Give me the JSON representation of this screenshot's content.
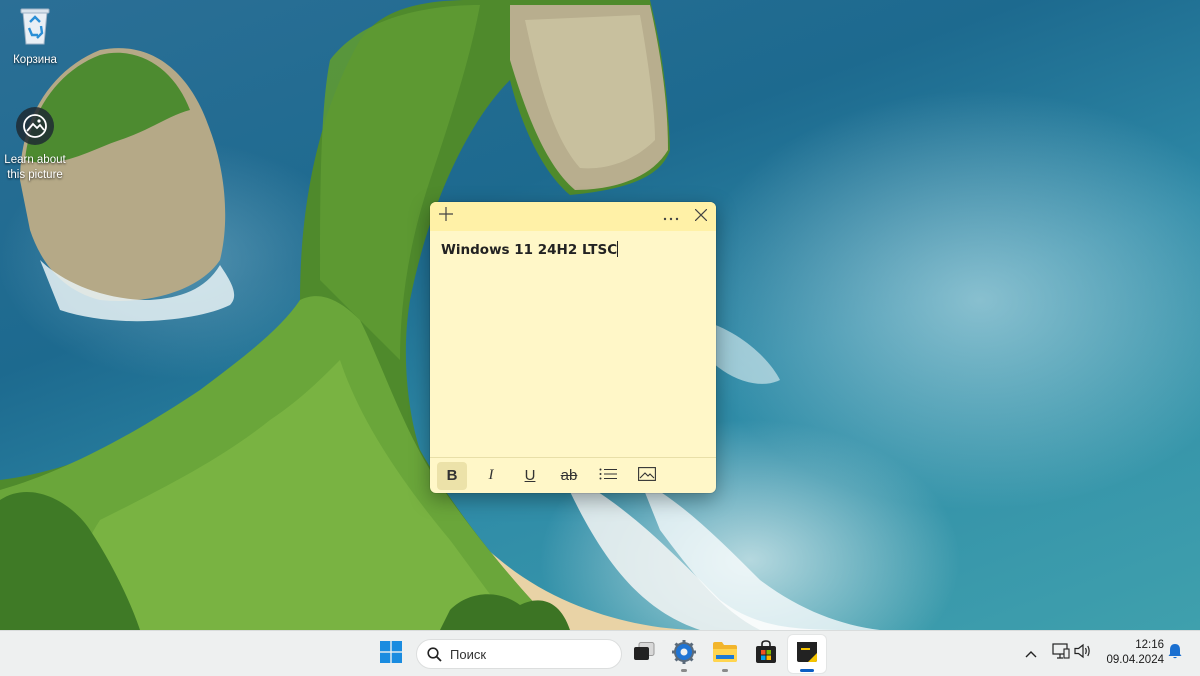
{
  "desktop": {
    "icons": [
      {
        "label": "Корзина",
        "icon": "recycle-bin-icon"
      },
      {
        "label_line1": "Learn about",
        "label_line2": "this picture",
        "icon": "camera-lens-icon"
      }
    ]
  },
  "sticky_note": {
    "title_bar": {
      "new_note_icon": "plus-icon",
      "menu_icon": "ellipsis-icon",
      "close_icon": "close-icon"
    },
    "content": "Windows 11 24H2 LTSC",
    "background_color": "#fff7c8",
    "titlebar_color": "#fff1a7",
    "toolbar": {
      "bold_label": "B",
      "italic_label": "I",
      "underline_label": "U",
      "strikethrough_label": "ab",
      "bullets_icon": "bullet-list-icon",
      "image_icon": "image-icon",
      "bold_active": true
    }
  },
  "taskbar": {
    "start_icon": "windows-logo-icon",
    "search_placeholder": "Поиск",
    "apps": [
      {
        "name": "task-view",
        "icon": "task-view-icon",
        "running": false
      },
      {
        "name": "settings",
        "icon": "gear-icon",
        "running": true
      },
      {
        "name": "file-explorer",
        "icon": "folder-icon",
        "running": true
      },
      {
        "name": "microsoft-store",
        "icon": "store-bag-icon",
        "running": false
      },
      {
        "name": "sticky-notes",
        "icon": "sticky-notes-icon",
        "running": true,
        "active": true
      }
    ],
    "tray": {
      "overflow_icon": "chevron-up-icon",
      "network_icon": "network-icon",
      "volume_icon": "speaker-icon",
      "notifications_icon": "bell-icon"
    },
    "clock": {
      "time": "12:16",
      "date": "09.04.2024"
    },
    "accent_color": "#0a5fc4"
  }
}
